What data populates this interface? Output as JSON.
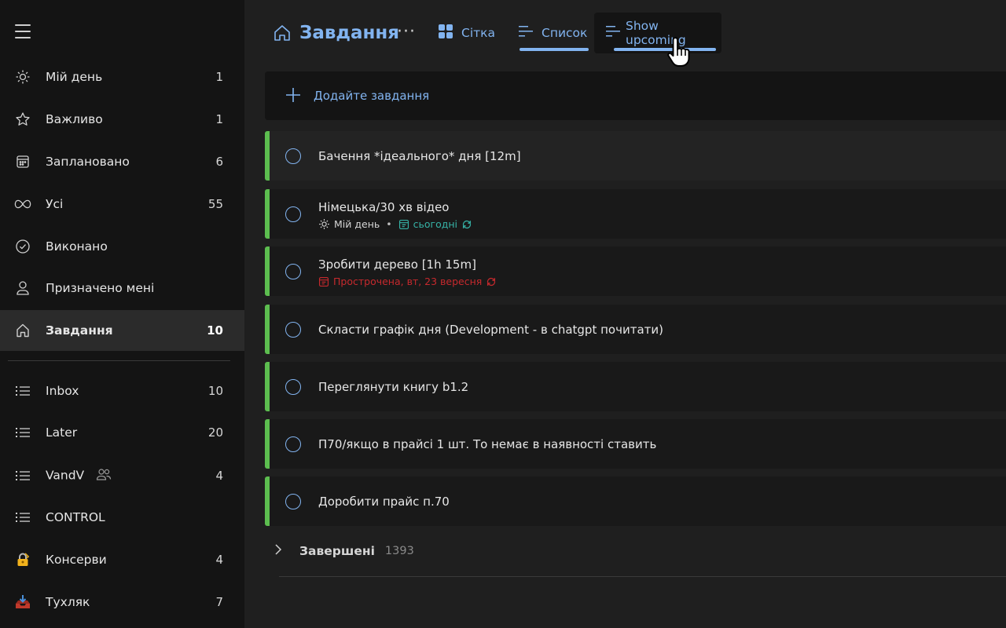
{
  "sidebar": {
    "items": [
      {
        "label": "Мій день",
        "count": "1",
        "icon": "sun-icon"
      },
      {
        "label": "Важливо",
        "count": "1",
        "icon": "star-icon"
      },
      {
        "label": "Заплановано",
        "count": "6",
        "icon": "calendar-icon"
      },
      {
        "label": "Усі",
        "count": "55",
        "icon": "infinity-icon"
      },
      {
        "label": "Виконано",
        "count": "",
        "icon": "check-circle-icon"
      },
      {
        "label": "Призначено мені",
        "count": "",
        "icon": "person-icon"
      },
      {
        "label": "Завдання",
        "count": "10",
        "icon": "home-icon"
      }
    ],
    "lists": [
      {
        "label": "Inbox",
        "count": "10",
        "icon": "list-icon"
      },
      {
        "label": "Later",
        "count": "20",
        "icon": "list-icon"
      },
      {
        "label": "VandV",
        "count": "4",
        "icon": "list-icon",
        "shared": true
      },
      {
        "label": "CONTROL",
        "count": "",
        "icon": "list-icon"
      },
      {
        "label": "Консерви",
        "count": "4",
        "icon": "lock-emoji-icon",
        "emoji": "🔐"
      },
      {
        "label": "Тухляк",
        "count": "7",
        "icon": "inbox-tray-emoji-icon",
        "emoji": "📥"
      }
    ]
  },
  "header": {
    "title": "Завдання",
    "more": "···",
    "views": {
      "grid": "Сітка",
      "list": "Список",
      "upcoming": "Show upcoming"
    }
  },
  "add_task": {
    "label": "Додайте завдання"
  },
  "tasks": [
    {
      "title": "Бачення *ідеального* дня [12m]"
    },
    {
      "title": "Німецька/30 хв відео",
      "meta": {
        "my_day": "Мій день",
        "sep": "•",
        "due": "сьогодні"
      }
    },
    {
      "title": "Зробити дерево [1h 15m]",
      "meta": {
        "overdue": "Прострочена, вт, 23 вересня"
      }
    },
    {
      "title": "Скласти графік дня (Development - в chatgpt почитати)"
    },
    {
      "title": "Переглянути книгу b1.2"
    },
    {
      "title": "П70/якщо в прайсі 1 шт. То немає в наявності ставить"
    },
    {
      "title": "Доробити прайс п.70"
    }
  ],
  "completed": {
    "label": "Завершені",
    "count": "1393"
  },
  "colors": {
    "accent": "#82b4f0",
    "list_bar": "#5cbd4f",
    "today": "#36b2a6",
    "overdue": "#c6292d",
    "sidebar_bg": "#141414",
    "main_bg": "#1f1f1f"
  }
}
